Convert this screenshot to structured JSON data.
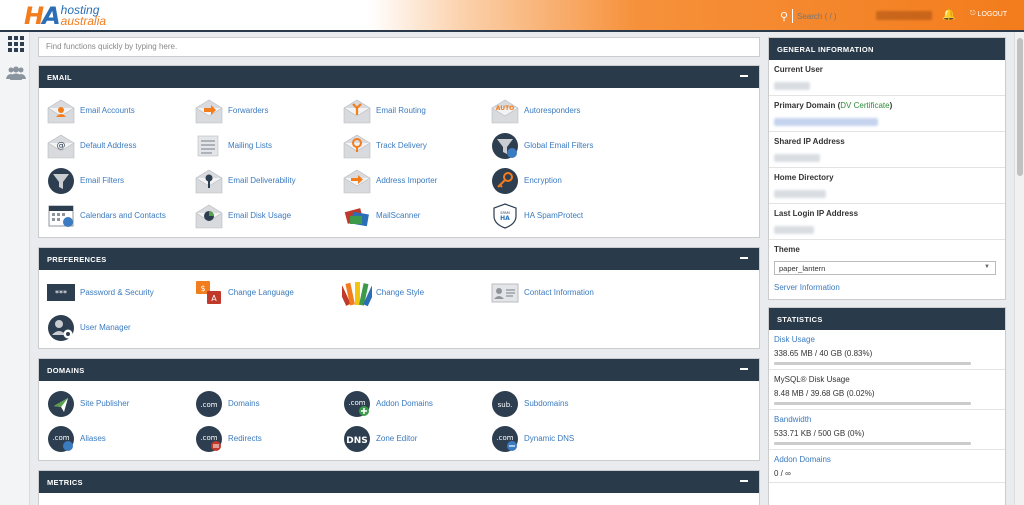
{
  "brand": {
    "mark_h": "H",
    "mark_a": "A",
    "line1": "hosting",
    "line2": "australia"
  },
  "header": {
    "search_placeholder": "Search ( / )",
    "logout_label": "LOGOUT"
  },
  "main": {
    "search_placeholder": "Find functions quickly by typing here.",
    "sections": [
      {
        "title": "EMAIL",
        "items": [
          {
            "label": "Email Accounts",
            "icon": "email-accounts-icon"
          },
          {
            "label": "Forwarders",
            "icon": "forwarders-icon"
          },
          {
            "label": "Email Routing",
            "icon": "email-routing-icon"
          },
          {
            "label": "Autoresponders",
            "icon": "autoresponders-icon"
          },
          {
            "label": "Default Address",
            "icon": "default-address-icon"
          },
          {
            "label": "Mailing Lists",
            "icon": "mailing-lists-icon"
          },
          {
            "label": "Track Delivery",
            "icon": "track-delivery-icon"
          },
          {
            "label": "Global Email Filters",
            "icon": "global-email-filters-icon"
          },
          {
            "label": "Email Filters",
            "icon": "email-filters-icon"
          },
          {
            "label": "Email Deliverability",
            "icon": "email-deliverability-icon"
          },
          {
            "label": "Address Importer",
            "icon": "address-importer-icon"
          },
          {
            "label": "Encryption",
            "icon": "encryption-icon"
          },
          {
            "label": "Calendars and Contacts",
            "icon": "calendars-contacts-icon"
          },
          {
            "label": "Email Disk Usage",
            "icon": "email-disk-usage-icon"
          },
          {
            "label": "MailScanner",
            "icon": "mailscanner-icon"
          },
          {
            "label": "HA SpamProtect",
            "icon": "spamprotect-icon"
          }
        ]
      },
      {
        "title": "PREFERENCES",
        "items": [
          {
            "label": "Password & Security",
            "icon": "password-security-icon"
          },
          {
            "label": "Change Language",
            "icon": "change-language-icon"
          },
          {
            "label": "Change Style",
            "icon": "change-style-icon"
          },
          {
            "label": "Contact Information",
            "icon": "contact-information-icon"
          },
          {
            "label": "User Manager",
            "icon": "user-manager-icon"
          }
        ]
      },
      {
        "title": "DOMAINS",
        "items": [
          {
            "label": "Site Publisher",
            "icon": "site-publisher-icon"
          },
          {
            "label": "Domains",
            "icon": "domains-icon"
          },
          {
            "label": "Addon Domains",
            "icon": "addon-domains-icon"
          },
          {
            "label": "Subdomains",
            "icon": "subdomains-icon"
          },
          {
            "label": "Aliases",
            "icon": "aliases-icon"
          },
          {
            "label": "Redirects",
            "icon": "redirects-icon"
          },
          {
            "label": "Zone Editor",
            "icon": "zone-editor-icon"
          },
          {
            "label": "Dynamic DNS",
            "icon": "dynamic-dns-icon"
          }
        ]
      },
      {
        "title": "METRICS",
        "items": []
      }
    ]
  },
  "general_info": {
    "title": "GENERAL INFORMATION",
    "current_user_label": "Current User",
    "primary_domain_label": "Primary Domain (",
    "dv_text": "DV Certificate",
    "primary_domain_close": ")",
    "shared_ip_label": "Shared IP Address",
    "home_dir_label": "Home Directory",
    "last_login_label": "Last Login IP Address",
    "theme_label": "Theme",
    "theme_value": "paper_lantern",
    "server_info_link": "Server Information"
  },
  "statistics": {
    "title": "STATISTICS",
    "items": [
      {
        "name": "Disk Usage",
        "value": "338.65 MB / 40 GB   (0.83%)",
        "link": true
      },
      {
        "name": "MySQL® Disk Usage",
        "value": "8.48 MB / 39.68 GB   (0.02%)",
        "link": false
      },
      {
        "name": "Bandwidth",
        "value": "533.71 KB / 500 GB   (0%)",
        "link": true
      },
      {
        "name": "Addon Domains",
        "value": "0 / ∞",
        "link": true
      }
    ]
  },
  "colors": {
    "accent": "#f37c1c",
    "nav": "#293a4a",
    "link": "#3b7bbf"
  }
}
